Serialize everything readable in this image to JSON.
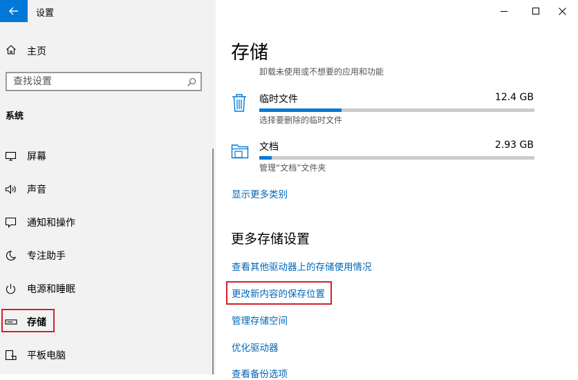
{
  "window": {
    "title": "设置"
  },
  "sidebar": {
    "home_label": "主页",
    "search_placeholder": "查找设置",
    "section_label": "系统",
    "items": [
      {
        "label": "屏幕",
        "icon": "monitor-icon"
      },
      {
        "label": "声音",
        "icon": "speaker-icon"
      },
      {
        "label": "通知和操作",
        "icon": "notification-icon"
      },
      {
        "label": "专注助手",
        "icon": "moon-icon"
      },
      {
        "label": "电源和睡眠",
        "icon": "power-icon"
      },
      {
        "label": "存储",
        "icon": "storage-icon",
        "selected": true
      },
      {
        "label": "平板电脑",
        "icon": "tablet-icon"
      }
    ]
  },
  "main": {
    "title": "存储",
    "subtitle": "卸载未使用或不想要的应用和功能",
    "categories": [
      {
        "name": "临时文件",
        "size": "12.4 GB",
        "desc": "选择要删除的临时文件",
        "usage_fraction": 0.3,
        "icon": "trash-icon"
      },
      {
        "name": "文档",
        "size": "2.93 GB",
        "desc": "管理“文档”文件夹",
        "usage_fraction": 0.045,
        "icon": "folder-icon"
      }
    ],
    "show_more_link": "显示更多类别",
    "more_settings_title": "更多存储设置",
    "links": [
      "查看其他驱动器上的存储使用情况",
      "更改新内容的保存位置",
      "管理存储空间",
      "优化驱动器",
      "查看备份选项"
    ]
  },
  "colors": {
    "accent": "#0078d7",
    "link": "#0067b8",
    "highlight_box": "#d0202a",
    "sidebar_bg": "#f2f2f2"
  }
}
